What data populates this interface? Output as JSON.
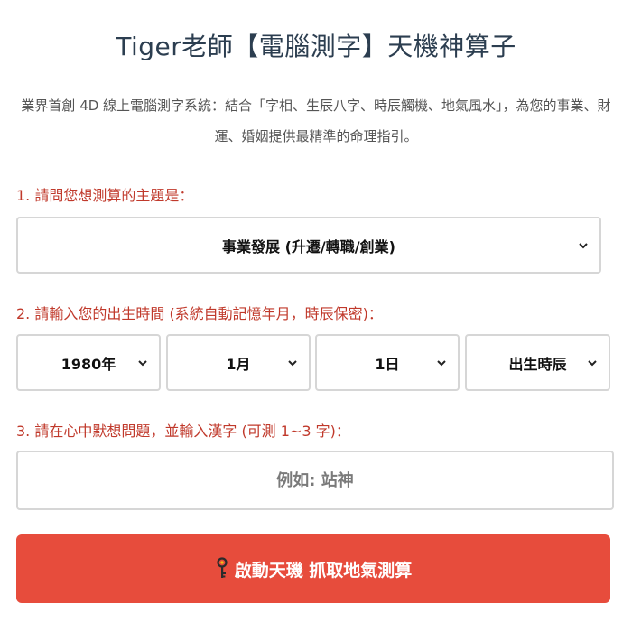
{
  "header": {
    "title": "Tiger老師【電腦測字】天機神算子",
    "description": "業界首創 4D 線上電腦測字系統：結合「字相、生辰八字、時辰觸機、地氣風水」，為您的事業、財運、婚姻提供最精準的命理指引。"
  },
  "questions": {
    "topic_label": "1. 請問您想測算的主題是：",
    "birth_label": "2. 請輸入您的出生時間 (系統自動記憶年月，時辰保密)：",
    "char_label": "3. 請在心中默想問題，並輸入漢字 (可測 1~3 字)："
  },
  "topic": {
    "selected": "事業發展 (升遷/轉職/創業)"
  },
  "birth": {
    "year": "1980年",
    "month": "1月",
    "day": "1日",
    "hour": "出生時辰"
  },
  "char_input": {
    "placeholder": "例如: 站神",
    "value": ""
  },
  "start_button": {
    "label": "啟動天璣 抓取地氣測算",
    "icon": "key-icon"
  },
  "colors": {
    "accent": "#e74c3c",
    "label_red": "#c0392b",
    "title": "#2c3e50"
  }
}
